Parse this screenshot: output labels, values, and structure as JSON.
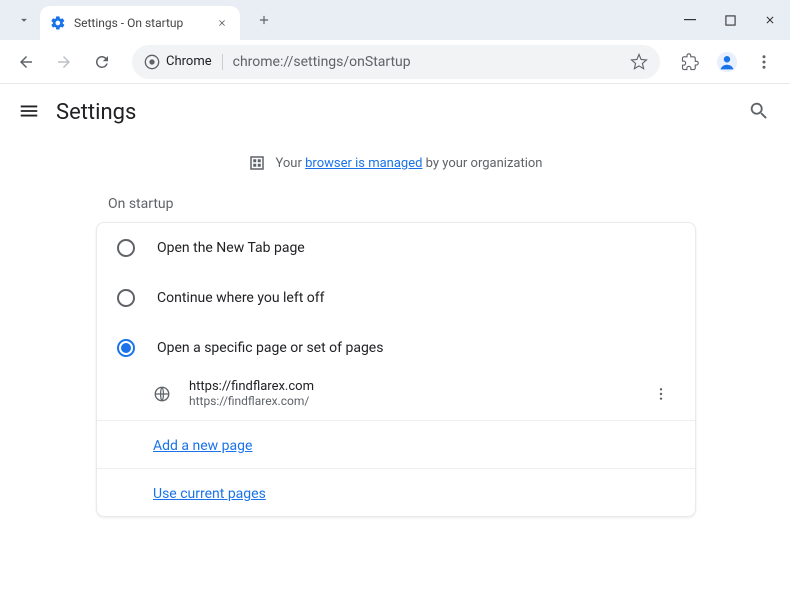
{
  "window": {
    "tab_title": "Settings - On startup"
  },
  "toolbar": {
    "chrome_chip": "Chrome",
    "url": "chrome://settings/onStartup"
  },
  "page": {
    "title": "Settings",
    "managed_prefix": "Your ",
    "managed_link": "browser is managed",
    "managed_suffix": " by your organization",
    "section_title": "On startup",
    "radios": [
      {
        "label": "Open the New Tab page"
      },
      {
        "label": "Continue where you left off"
      },
      {
        "label": "Open a specific page or set of pages"
      }
    ],
    "startup_page": {
      "name": "https://findflarex.com",
      "url": "https://findflarex.com/"
    },
    "add_link": "Add a new page",
    "use_current_link": "Use current pages"
  }
}
